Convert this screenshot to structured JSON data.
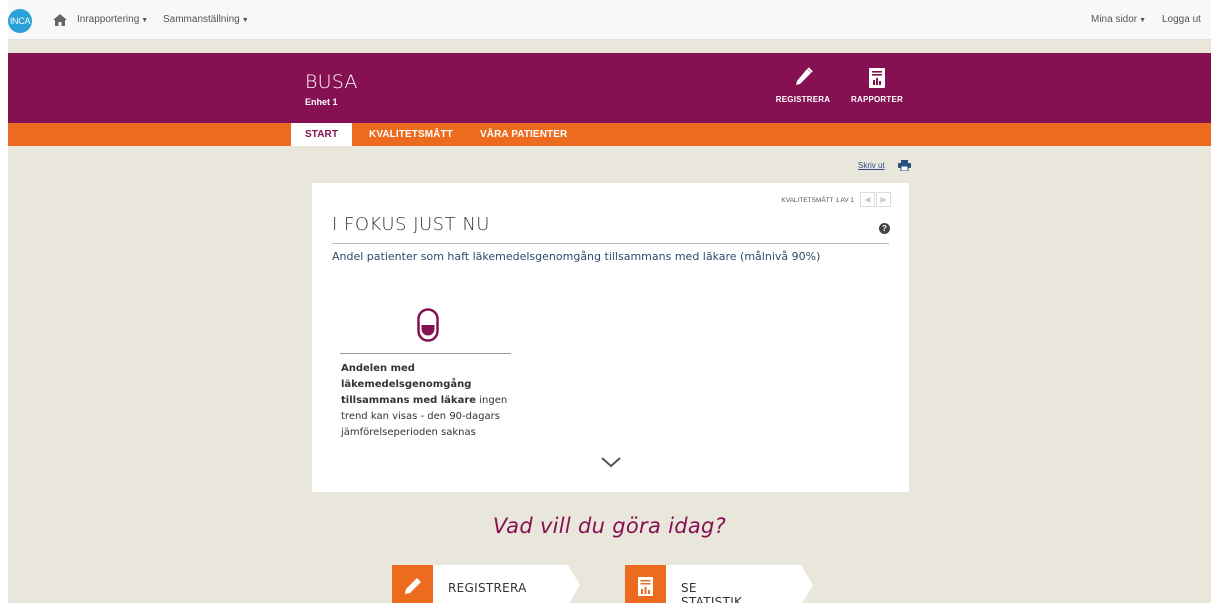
{
  "topnav": {
    "logo_text": "INCA",
    "reporting_label": "Inrapportering",
    "summary_label": "Sammanställning",
    "my_pages_label": "Mina sidor",
    "logout_label": "Logga ut"
  },
  "header": {
    "brand": "BUSA",
    "unit": "Enhet 1",
    "register_label": "REGISTRERA",
    "reports_label": "RAPPORTER",
    "background_color": "#861152"
  },
  "tabs": [
    {
      "label": "START",
      "active": true
    },
    {
      "label": "KVALITETSMÅTT",
      "active": false
    },
    {
      "label": "VÅRA PATIENTER",
      "active": false
    }
  ],
  "print_label": "Skriv ut",
  "focus": {
    "counter": "KVALITETSMÅTT 1 AV 1",
    "title": "I FOKUS JUST NU",
    "help_symbol": "?",
    "subtitle": "Andel patienter som haft läkemedelsgenomgång tillsammans med läkare (målnivå 90%)",
    "desc_bold": "Andelen med läkemedelsgenomgång tillsammans med läkare",
    "desc_rest": " ingen trend kan visas - den 90-dagars jämförelseperioden saknas",
    "icon": "pill-icon"
  },
  "question": "Vad vill du göra idag?",
  "actions": [
    {
      "label": "REGISTRERA",
      "icon": "pencil-icon"
    },
    {
      "label": "SE STATISTIK",
      "icon": "report-icon"
    }
  ],
  "colors": {
    "accent": "#ed6b1f",
    "brand": "#861152",
    "page_bg": "#e9e6dc"
  }
}
